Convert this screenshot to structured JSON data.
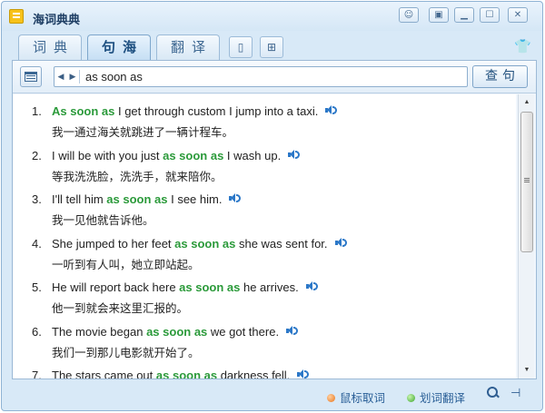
{
  "window": {
    "title": "海词典典"
  },
  "titlebar_buttons": [
    "chat-icon",
    "restore-icon",
    "minimize-icon",
    "maximize-icon",
    "close-icon"
  ],
  "tabs": [
    {
      "label": "词典",
      "active": false
    },
    {
      "label": "句海",
      "active": true
    },
    {
      "label": "翻译",
      "active": false
    }
  ],
  "search": {
    "value": "as soon as",
    "button_label": "查句"
  },
  "results": [
    {
      "num": "1.",
      "before": "",
      "hl": "As soon as",
      "after": " I get through custom I jump into a taxi.",
      "cn": "我一通过海关就跳进了一辆计程车。"
    },
    {
      "num": "2.",
      "before": "I will be with you just ",
      "hl": "as soon as",
      "after": " I wash up.",
      "cn": "等我洗洗脸，洗洗手，就来陪你。"
    },
    {
      "num": "3.",
      "before": "I'll tell him ",
      "hl": "as soon as",
      "after": " I see him.",
      "cn": "我一见他就告诉他。"
    },
    {
      "num": "4.",
      "before": "She jumped to her feet ",
      "hl": "as soon as",
      "after": " she was sent for.",
      "cn": "一听到有人叫，她立即站起。"
    },
    {
      "num": "5.",
      "before": "He will report back here ",
      "hl": "as soon as",
      "after": " he arrives.",
      "cn": "他一到就会来这里汇报的。"
    },
    {
      "num": "6.",
      "before": "The movie began ",
      "hl": "as soon as",
      "after": " we got there.",
      "cn": "我们一到那儿电影就开始了。"
    },
    {
      "num": "7.",
      "before": "The stars came out ",
      "hl": "as soon as",
      "after": " darkness fell.",
      "cn": ""
    }
  ],
  "statusbar": {
    "mouse_lookup": "鼠标取词",
    "selection_translate": "划词翻译"
  },
  "colors": {
    "highlight": "#2b9a3a",
    "link": "#2a5f97",
    "accent": "#2c78c8"
  }
}
